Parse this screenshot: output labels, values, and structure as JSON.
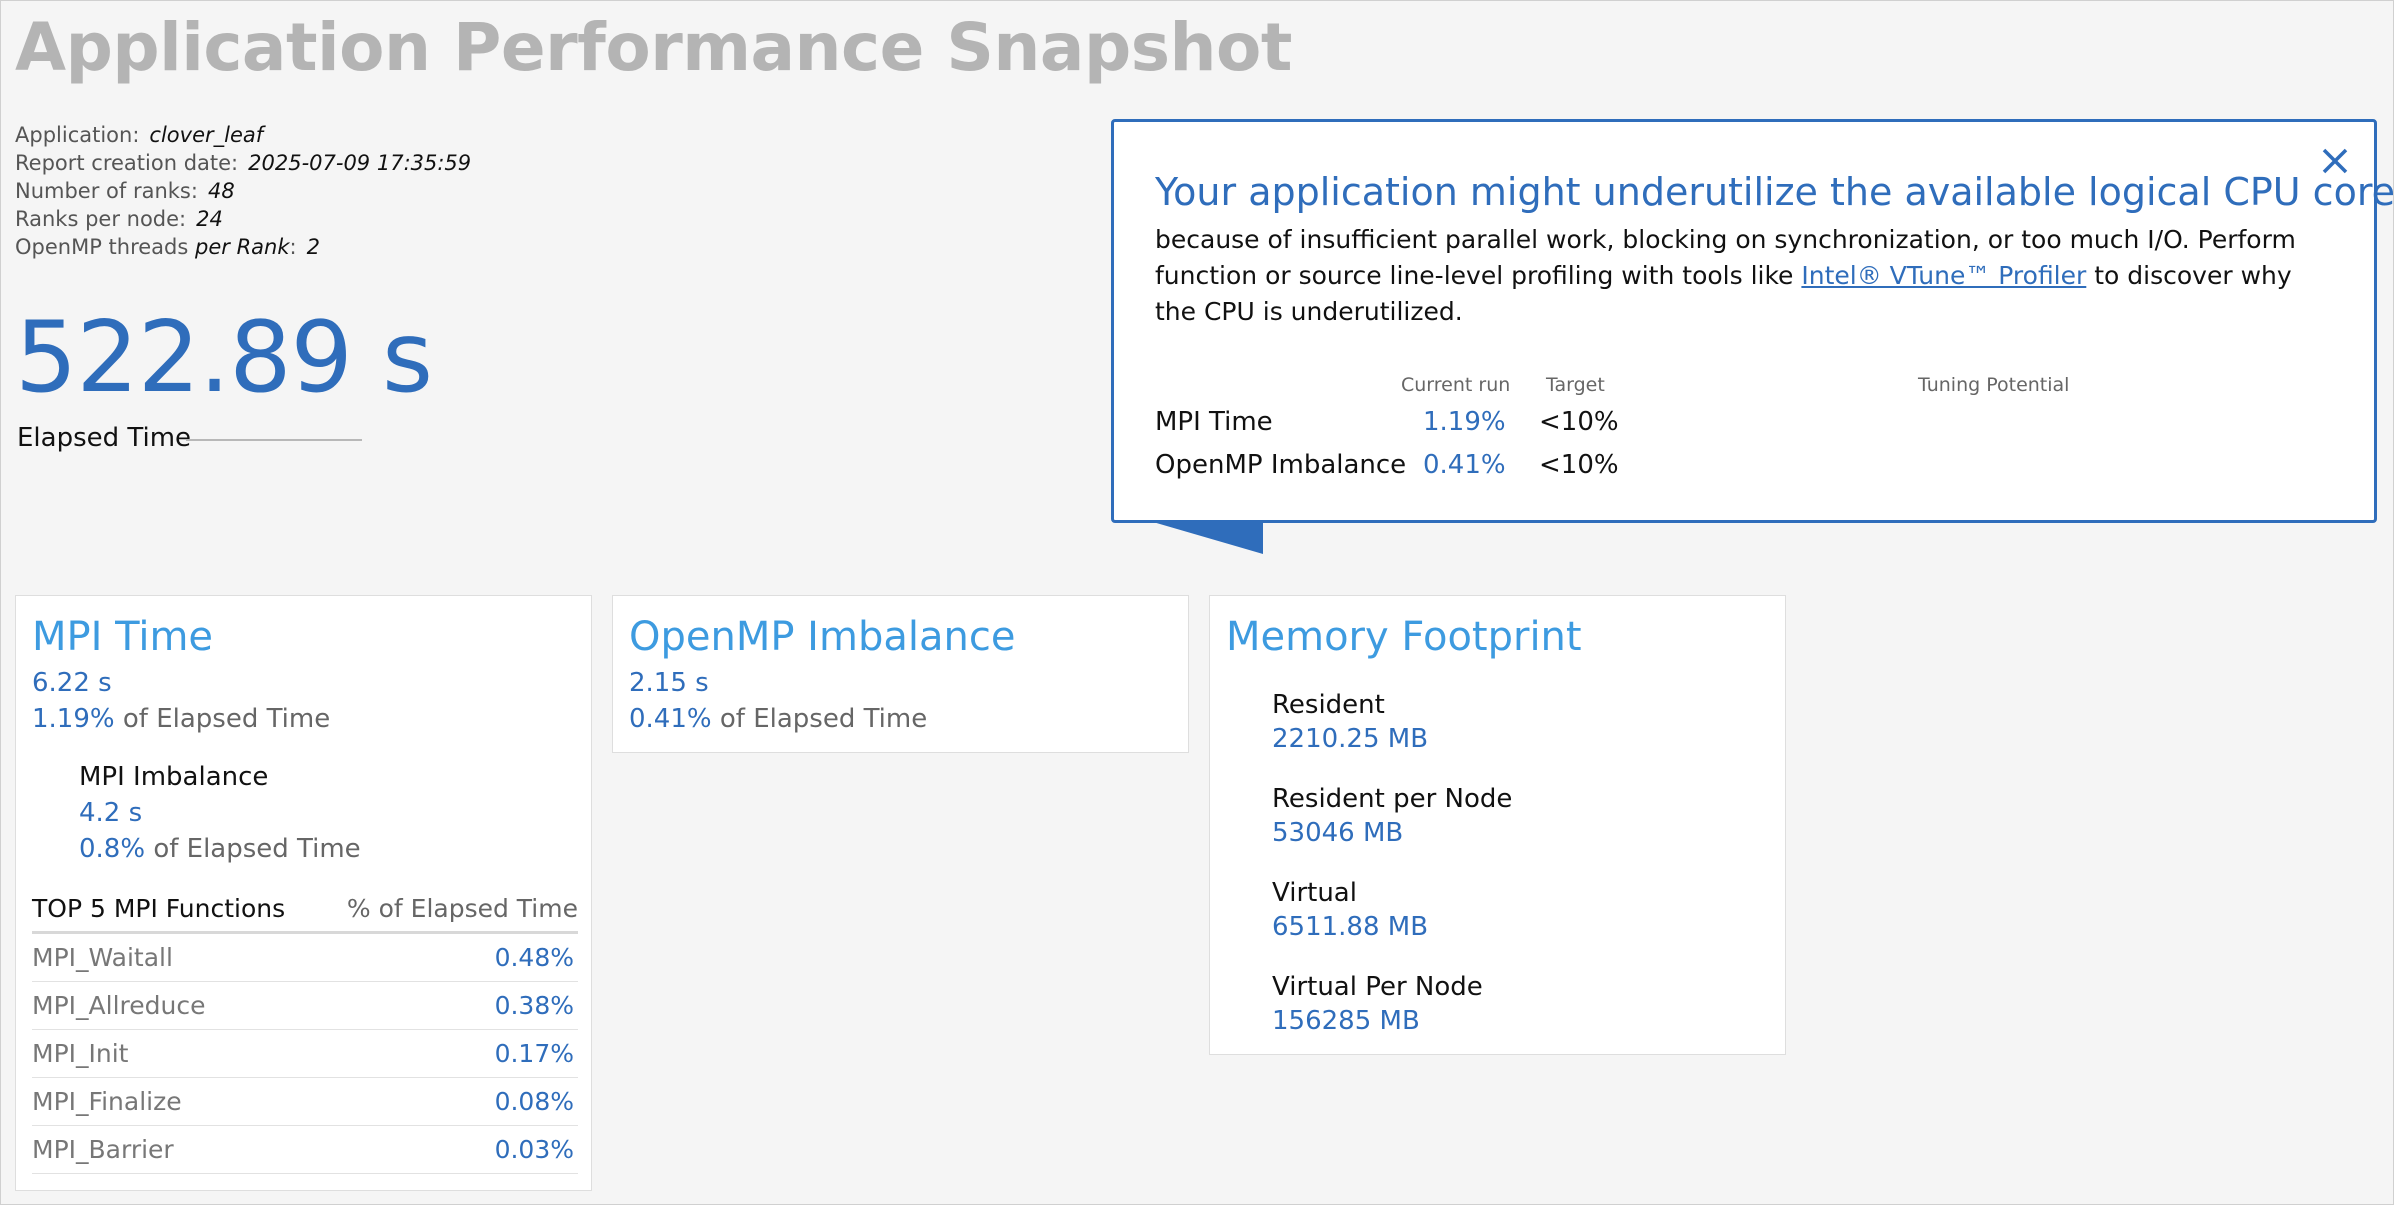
{
  "title": "Application Performance Snapshot",
  "meta": {
    "application_label": "Application:",
    "application_value": "clover_leaf",
    "report_date_label": "Report creation date:",
    "report_date_value": "2025-07-09 17:35:59",
    "ranks_label": "Number of ranks:",
    "ranks_value": "48",
    "ranks_per_node_label": "Ranks per node:",
    "ranks_per_node_value": "24",
    "omp_threads_label_a": "OpenMP threads",
    "omp_threads_label_b": "per Rank",
    "omp_threads_colon": ":",
    "omp_threads_value": "2"
  },
  "elapsed": {
    "value": "522.89 s",
    "label": "Elapsed Time"
  },
  "popup": {
    "heading": "Your application might underutilize the available logical CPU cores",
    "body_pre": "because of insufficient parallel work, blocking on synchronization, or too much I/O. Perform function or source line-level profiling with tools like ",
    "link_text": "Intel® VTune™ Profiler",
    "body_post": " to discover why the CPU is underutilized.",
    "col_current": "Current run",
    "col_target": "Target",
    "col_tuning": "Tuning Potential",
    "rows": [
      {
        "label": "MPI Time",
        "current": "1.19%",
        "target": "<10%"
      },
      {
        "label": "OpenMP Imbalance",
        "current": "0.41%",
        "target": "<10%"
      }
    ],
    "close_icon": "close-icon",
    "accent": "#2f6dbb"
  },
  "mpi_card": {
    "title": "MPI Time",
    "time": "6.22 s",
    "pct": "1.19%",
    "of_elapsed": " of Elapsed Time",
    "imbalance_title": "MPI Imbalance",
    "imbalance_time": "4.2 s",
    "imbalance_pct": "0.8%",
    "imbalance_of_elapsed": " of Elapsed Time",
    "table_header_name": "TOP 5 MPI Functions",
    "table_header_value": "% of Elapsed Time",
    "functions": [
      {
        "name": "MPI_Waitall",
        "value": "0.48%"
      },
      {
        "name": "MPI_Allreduce",
        "value": "0.38%"
      },
      {
        "name": "MPI_Init",
        "value": "0.17%"
      },
      {
        "name": "MPI_Finalize",
        "value": "0.08%"
      },
      {
        "name": "MPI_Barrier",
        "value": "0.03%"
      }
    ]
  },
  "omp_card": {
    "title": "OpenMP Imbalance",
    "time": "2.15 s",
    "pct": "0.41%",
    "of_elapsed": " of Elapsed Time"
  },
  "mem_card": {
    "title": "Memory Footprint",
    "items": [
      {
        "label": "Resident",
        "value": "2210.25 MB"
      },
      {
        "label": "Resident per Node",
        "value": "53046 MB"
      },
      {
        "label": "Virtual",
        "value": "6511.88 MB"
      },
      {
        "label": "Virtual Per Node",
        "value": "156285 MB"
      }
    ]
  },
  "colors": {
    "title_gray": "#b4b4b4",
    "value_blue": "#2f6dbb",
    "card_title_blue": "#3d9be0"
  }
}
